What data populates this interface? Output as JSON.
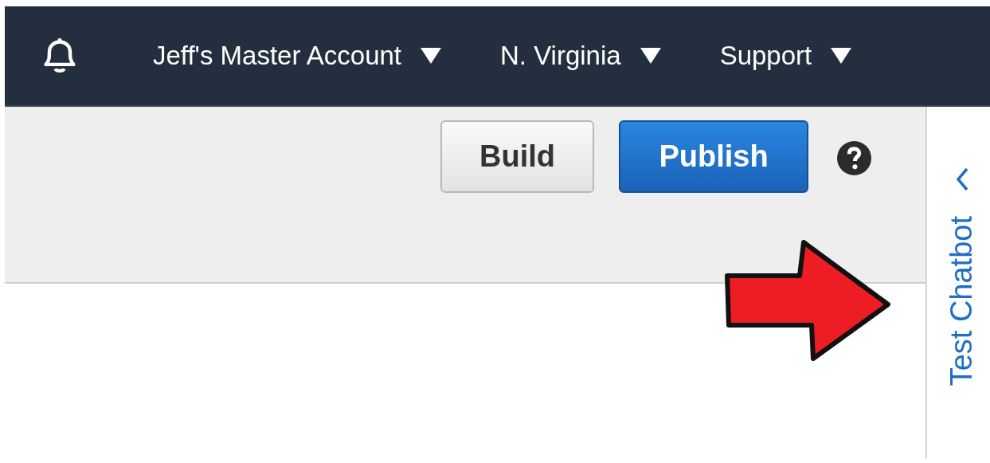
{
  "top_bar": {
    "menus": [
      {
        "label": "Jeff's Master Account"
      },
      {
        "label": "N. Virginia"
      },
      {
        "label": "Support"
      }
    ]
  },
  "toolbar": {
    "buttons": [
      {
        "label": "Build",
        "kind": "secondary"
      },
      {
        "label": "Publish",
        "kind": "primary"
      }
    ]
  },
  "side_panel": {
    "title": "Test Chatbot"
  }
}
